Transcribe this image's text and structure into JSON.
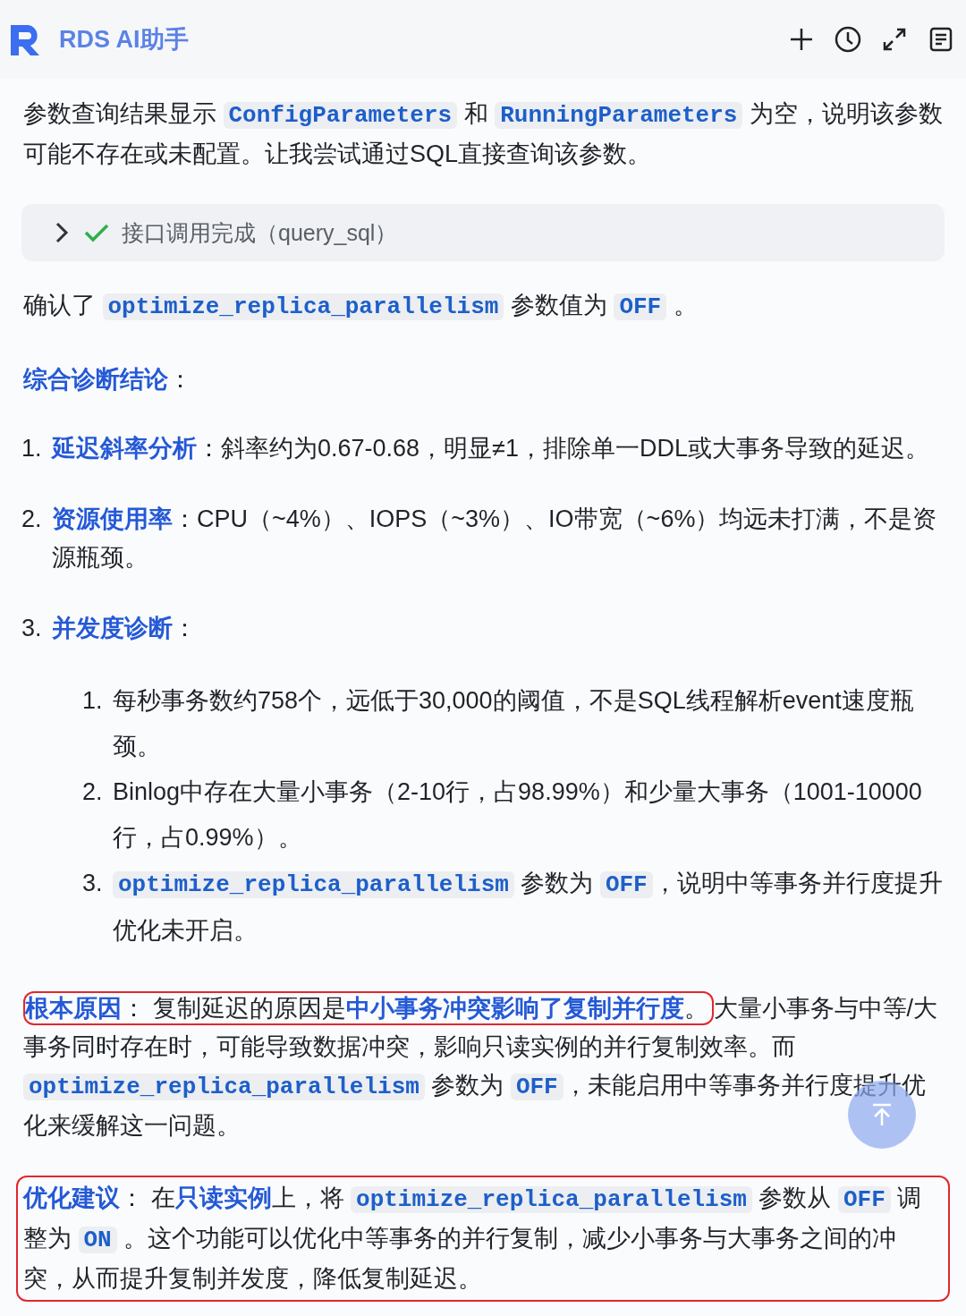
{
  "header": {
    "title": "RDS AI助手"
  },
  "blocks": [
    {
      "kind": "paragraph",
      "boxed": false,
      "runs": [
        {
          "kind": "text",
          "text": "参数查询结果显示 "
        },
        {
          "kind": "code",
          "text": "ConfigParameters"
        },
        {
          "kind": "text",
          "text": " 和 "
        },
        {
          "kind": "code",
          "text": "RunningParameters"
        },
        {
          "kind": "text",
          "text": " 为空，说明该参数可能不存在或未配置。让我尝试通过SQL直接查询该参数。"
        }
      ]
    },
    {
      "kind": "tool_call",
      "expanded": false,
      "label": "接口调用完成（query_sql）"
    },
    {
      "kind": "paragraph",
      "boxed": false,
      "runs": [
        {
          "kind": "text",
          "text": "确认了 "
        },
        {
          "kind": "code",
          "text": "optimize_replica_parallelism"
        },
        {
          "kind": "text",
          "text": " 参数值为 "
        },
        {
          "kind": "code",
          "text": "OFF"
        },
        {
          "kind": "text",
          "text": " 。"
        }
      ]
    },
    {
      "kind": "paragraph",
      "boxed": false,
      "runs": [
        {
          "kind": "term",
          "text": "综合诊断结论"
        },
        {
          "kind": "text",
          "text": "："
        }
      ]
    },
    {
      "kind": "list",
      "items": [
        {
          "number": "1.",
          "runs": [
            {
              "kind": "term",
              "text": "延迟斜率分析"
            },
            {
              "kind": "text",
              "text": "：斜率约为0.67-0.68，明显≠1，排除单一DDL或大事务导致的延迟。"
            }
          ]
        },
        {
          "number": "2.",
          "runs": [
            {
              "kind": "term",
              "text": "资源使用率"
            },
            {
              "kind": "text",
              "text": "：CPU（~4%）、IOPS（~3%）、IO带宽（~6%）均远未打满，不是资源瓶颈。"
            }
          ]
        },
        {
          "number": "3.",
          "runs": [
            {
              "kind": "term",
              "text": "并发度诊断"
            },
            {
              "kind": "text",
              "text": "："
            }
          ],
          "children": [
            {
              "number": "1.",
              "runs": [
                {
                  "kind": "text",
                  "text": "每秒事务数约758个，远低于30,000的阈值，不是SQL线程解析event速度瓶颈。"
                }
              ]
            },
            {
              "number": "2.",
              "runs": [
                {
                  "kind": "text",
                  "text": "Binlog中存在大量小事务（2-10行，占98.99%）和少量大事务（1001-10000行，占0.99%）。"
                }
              ]
            },
            {
              "number": "3.",
              "runs": [
                {
                  "kind": "code",
                  "text": "optimize_replica_parallelism"
                },
                {
                  "kind": "text",
                  "text": " 参数为 "
                },
                {
                  "kind": "code",
                  "text": "OFF"
                },
                {
                  "kind": "text",
                  "text": "，说明中等事务并行度提升优化未开启。"
                }
              ]
            }
          ]
        }
      ]
    },
    {
      "kind": "paragraph",
      "boxed": false,
      "runs": [
        {
          "kind": "boxed",
          "runs": [
            {
              "kind": "term",
              "text": "根本原因"
            },
            {
              "kind": "text",
              "text": "： 复制延迟的原因是"
            },
            {
              "kind": "term",
              "text": "中小事务冲突影响了复制并行度"
            },
            {
              "kind": "text",
              "text": "。"
            }
          ]
        },
        {
          "kind": "text",
          "text": "大量小事务与中等/大事务同时存在时，可能导致数据冲突，影响只读实例的并行复制效率。而 "
        },
        {
          "kind": "code",
          "text": "optimize_replica_parallelism"
        },
        {
          "kind": "text",
          "text": " 参数为 "
        },
        {
          "kind": "code",
          "text": "OFF"
        },
        {
          "kind": "text",
          "text": "，未能启用中等事务并行度提升优化来缓解这一问题。"
        }
      ]
    },
    {
      "kind": "paragraph",
      "boxed": true,
      "runs": [
        {
          "kind": "term",
          "text": "优化建议"
        },
        {
          "kind": "text",
          "text": "： 在"
        },
        {
          "kind": "term",
          "text": "只读实例"
        },
        {
          "kind": "text",
          "text": "上，将 "
        },
        {
          "kind": "code",
          "text": "optimize_replica_parallelism"
        },
        {
          "kind": "text",
          "text": " 参数从 "
        },
        {
          "kind": "code",
          "text": "OFF"
        },
        {
          "kind": "text",
          "text": " 调整为 "
        },
        {
          "kind": "code",
          "text": "ON"
        },
        {
          "kind": "text",
          "text": " 。这个功能可以优化中等事务的并行复制，减少小事务与大事务之间的冲突，从而提升复制并发度，降低复制延迟。"
        }
      ]
    }
  ]
}
